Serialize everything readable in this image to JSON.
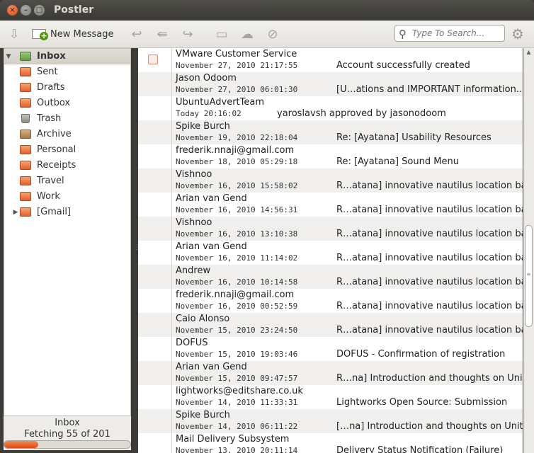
{
  "window": {
    "title": "Postler"
  },
  "toolbar": {
    "new_message_label": "New Message",
    "search_placeholder": "Type To Search..."
  },
  "sidebar": {
    "folders": [
      {
        "label": "Inbox",
        "icon": "inbox-icon",
        "selected": true
      },
      {
        "label": "Sent",
        "icon": "sent-folder-icon"
      },
      {
        "label": "Drafts",
        "icon": "folder-icon"
      },
      {
        "label": "Outbox",
        "icon": "outbox-folder-icon"
      },
      {
        "label": "Trash",
        "icon": "trash-icon"
      },
      {
        "label": "Archive",
        "icon": "archive-icon"
      },
      {
        "label": "Personal",
        "icon": "folder-icon"
      },
      {
        "label": "Receipts",
        "icon": "folder-icon"
      },
      {
        "label": "Travel",
        "icon": "folder-icon"
      },
      {
        "label": "Work",
        "icon": "folder-icon"
      },
      {
        "label": "[Gmail]",
        "icon": "folder-icon",
        "expandable": true
      }
    ],
    "status_title": "Inbox",
    "status_text": "Fetching 55 of 201",
    "progress_fraction": 0.27
  },
  "messages": [
    {
      "sender": "VMware Customer Service",
      "date": "November 27, 2010 21:17:55",
      "subject": "Account successfully created"
    },
    {
      "sender": "Jason Odoom",
      "date": "November 27, 2010 06:01:30",
      "subject": "[U…ations and IMPORTANT information…"
    },
    {
      "sender": "UbuntuAdvertTeam",
      "date": "Today 20:16:02",
      "subject": "yaroslavsh approved by jasonodoom"
    },
    {
      "sender": "Spike Burch",
      "date": "November 19, 2010 22:18:04",
      "subject": "Re: [Ayatana] Usability Resources"
    },
    {
      "sender": "frederik.nnaji@gmail.com",
      "date": "November 18, 2010 05:29:18",
      "subject": "Re: [Ayatana] Sound Menu"
    },
    {
      "sender": "Vishnoo",
      "date": "November 16, 2010 15:58:02",
      "subject": "R…atana] innovative nautilus location bar"
    },
    {
      "sender": "Arian van Gend",
      "date": "November 16, 2010 14:56:31",
      "subject": "R…atana] innovative nautilus location bar"
    },
    {
      "sender": "Vishnoo",
      "date": "November 16, 2010 13:10:38",
      "subject": "R…atana] innovative nautilus location bar"
    },
    {
      "sender": "Arian van Gend",
      "date": "November 16, 2010 11:14:02",
      "subject": "R…atana] innovative nautilus location bar"
    },
    {
      "sender": "Andrew",
      "date": "November 16, 2010 10:14:58",
      "subject": "R…atana] innovative nautilus location bar"
    },
    {
      "sender": "frederik.nnaji@gmail.com",
      "date": "November 16, 2010 00:52:59",
      "subject": "R…atana] innovative nautilus location bar"
    },
    {
      "sender": "Caio Alonso",
      "date": "November 15, 2010 23:24:50",
      "subject": "R…atana] innovative nautilus location bar"
    },
    {
      "sender": "DOFUS",
      "date": "November 15, 2010 19:03:46",
      "subject": "DOFUS - Confirmation of registration"
    },
    {
      "sender": "Arian van Gend",
      "date": "November 15, 2010 09:47:57",
      "subject": "R…na] Introduction and thoughts on Unity"
    },
    {
      "sender": "lightworks@editshare.co.uk",
      "date": "November 14, 2010 11:33:31",
      "subject": "Lightworks Open Source: Submission"
    },
    {
      "sender": "Spike Burch",
      "date": "November 14, 2010 06:11:22",
      "subject": "[…na] Introduction and thoughts on Unity"
    },
    {
      "sender": "Mail Delivery Subsystem",
      "date": "November 13, 2010 20:11:14",
      "subject": "Delivery Status Notification (Failure)"
    }
  ]
}
